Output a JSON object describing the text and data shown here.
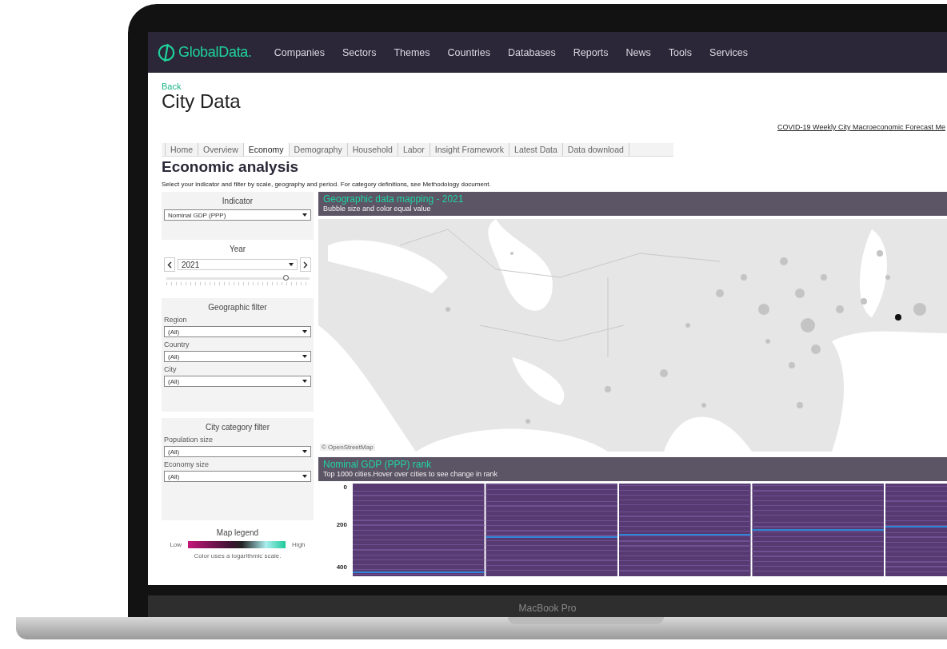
{
  "nav": {
    "logo": "GlobalData.",
    "items": [
      "Companies",
      "Sectors",
      "Themes",
      "Countries",
      "Databases",
      "Reports",
      "News",
      "Tools",
      "Services"
    ]
  },
  "page": {
    "back": "Back",
    "title": "City Data",
    "link": "COVID-19 Weekly City Macroeconomic Forecast Me"
  },
  "tabs": [
    {
      "label": "Home",
      "selected": false
    },
    {
      "label": "Overview",
      "selected": false
    },
    {
      "label": "Economy",
      "selected": true
    },
    {
      "label": "Demography",
      "selected": false
    },
    {
      "label": "Household",
      "selected": false
    },
    {
      "label": "Labor",
      "selected": false
    },
    {
      "label": "Insight Framework",
      "selected": false
    },
    {
      "label": "Latest Data",
      "selected": false
    },
    {
      "label": "Data download",
      "selected": false
    }
  ],
  "section": {
    "heading": "Economic analysis",
    "description": "Select your indicator and filter by scale, geography and period. For category definitions, see Methodology document."
  },
  "sidebar": {
    "indicator": {
      "title": "Indicator",
      "value": "Nominal GDP (PPP)"
    },
    "year": {
      "title": "Year",
      "value": "2021",
      "level": 0.84
    },
    "geographic_filter": {
      "title": "Geographic filter",
      "fields": [
        {
          "label": "Region",
          "value": "(All)"
        },
        {
          "label": "Country",
          "value": "(All)"
        },
        {
          "label": "City",
          "value": "(All)"
        }
      ]
    },
    "city_category_filter": {
      "title": "City category filter",
      "fields": [
        {
          "label": "Population size",
          "value": "(All)"
        },
        {
          "label": "Economy size",
          "value": "(All)"
        }
      ]
    },
    "legend": {
      "title": "Map legend",
      "low": "Low",
      "high": "High",
      "note": "Color uses a logarithmic scale."
    }
  },
  "map": {
    "title": "Geographic data mapping - 2021",
    "subtitle": "Bubble size and color equal value",
    "attribution": "© OpenStreetMap"
  },
  "rank": {
    "title": "Nominal GDP (PPP) rank",
    "subtitle": "Top 1000 cities.Hover over cities to see change in rank",
    "y_ticks": [
      "0",
      "200",
      "400"
    ]
  },
  "device_label": "MacBook Pro"
}
